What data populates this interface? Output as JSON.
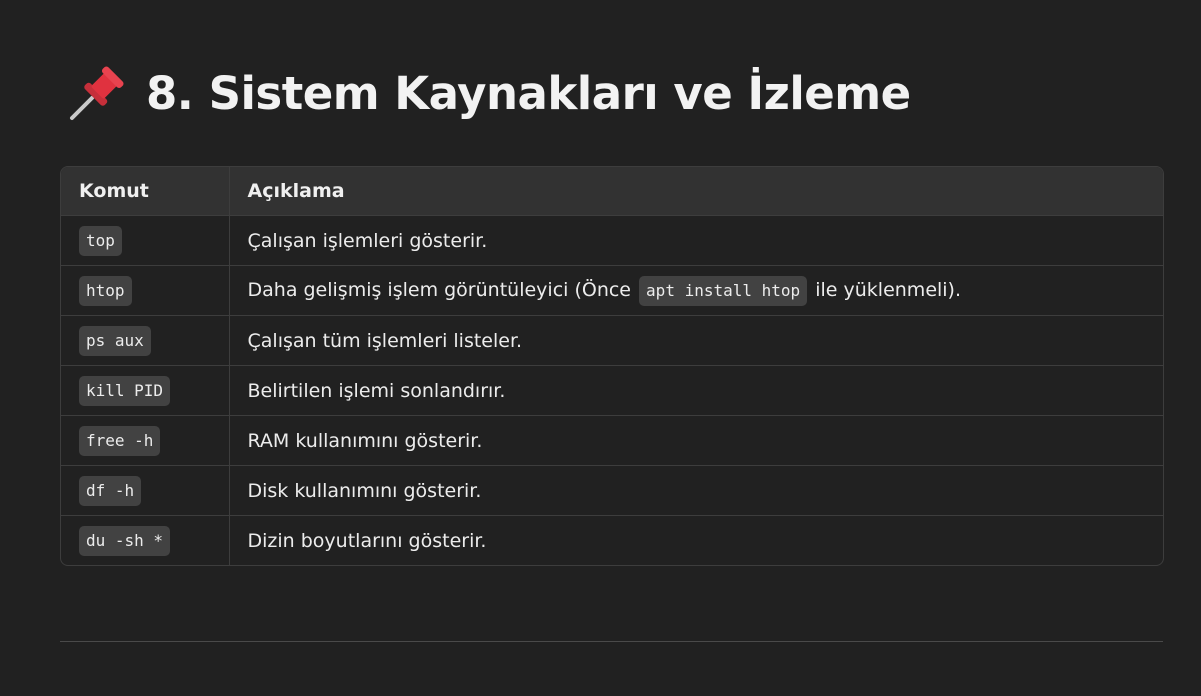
{
  "heading": {
    "icon": "pushpin-icon",
    "title": "8. Sistem Kaynakları ve İzleme"
  },
  "table": {
    "headers": [
      "Komut",
      "Açıklama"
    ],
    "rows": [
      {
        "command": "top",
        "description": "Çalışan işlemleri gösterir."
      },
      {
        "command": "htop",
        "description_before": "Daha gelişmiş işlem görüntüleyici (Önce",
        "description_code": "apt install htop",
        "description_after": "ile yüklenmeli)."
      },
      {
        "command": "ps aux",
        "description": "Çalışan tüm işlemleri listeler."
      },
      {
        "command": "kill PID",
        "description": "Belirtilen işlemi sonlandırır."
      },
      {
        "command": "free -h",
        "description": "RAM kullanımını gösterir."
      },
      {
        "command": "df -h",
        "description": "Disk kullanımını gösterir."
      },
      {
        "command": "du -sh *",
        "description": "Dizin boyutlarını gösterir."
      }
    ]
  },
  "colors": {
    "background": "#212121",
    "header_background": "#323232",
    "border": "#3d3d3d",
    "code_background": "#424242",
    "pin_red": "#e0323f"
  }
}
